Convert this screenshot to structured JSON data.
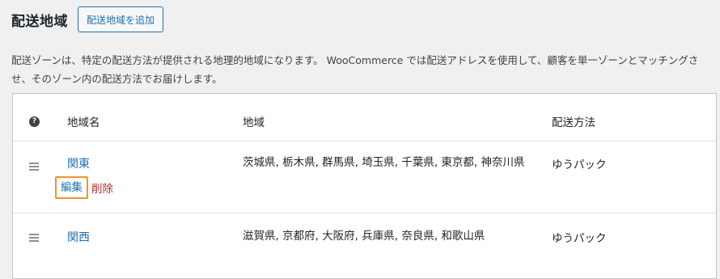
{
  "header": {
    "title": "配送地域",
    "add_button": "配送地域を追加"
  },
  "description": "配送ゾーンは、特定の配送方法が提供される地理的地域になります。 WooCommerce では配送アドレスを使用して、顧客を単一ゾーンとマッチングさせ、そのゾーン内の配送方法でお届けします。",
  "table": {
    "headers": {
      "help": "?",
      "zone_name": "地域名",
      "region": "地域",
      "methods": "配送方法"
    },
    "rows": [
      {
        "name": "関東",
        "regions": "茨城県, 栃木県, 群馬県, 埼玉県, 千葉県, 東京都, 神奈川県",
        "methods": "ゆうパック",
        "edit": "編集",
        "delete": "削除"
      },
      {
        "name": "関西",
        "regions": "滋賀県, 京都府, 大阪府, 兵庫県, 奈良県, 和歌山県",
        "methods": "ゆうパック"
      }
    ]
  },
  "colors": {
    "link": "#2271b1",
    "delete": "#b32d2e",
    "highlight": "#f0932b"
  }
}
